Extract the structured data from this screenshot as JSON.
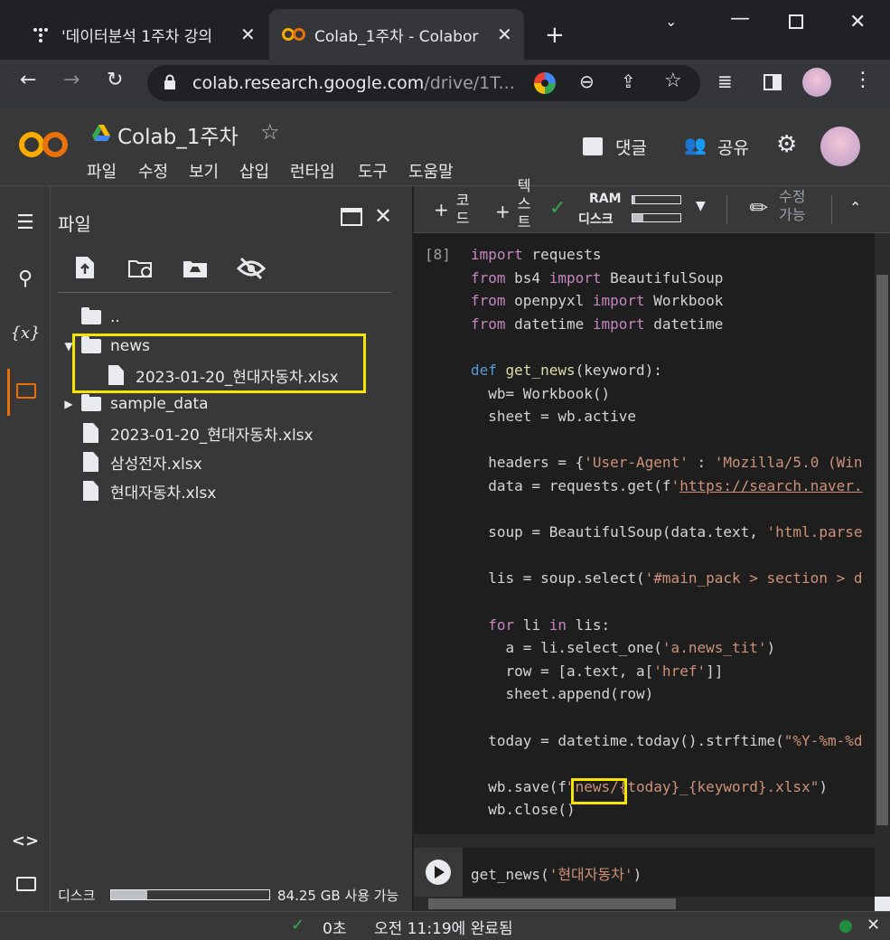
{
  "browser": {
    "tabs": [
      {
        "title": "'데이터분석 1주차 강의",
        "active": false
      },
      {
        "title": "Colab_1주차 - Colabor",
        "active": true
      }
    ],
    "new_tab_label": "+",
    "address": {
      "host": "colab.research.google.com",
      "path": "/drive/1T..."
    }
  },
  "colab": {
    "logo_text": "CO",
    "notebook_title": "Colab_1주차",
    "menu": [
      "파일",
      "수정",
      "보기",
      "삽입",
      "런타임",
      "도구",
      "도움말"
    ],
    "comment_label": "댓글",
    "share_label": "공유"
  },
  "files_panel": {
    "title": "파일",
    "parent_dir": "..",
    "tree": [
      {
        "name": "news",
        "type": "folder",
        "expanded": true
      },
      {
        "name": "2023-01-20_현대자동차.xlsx",
        "type": "file",
        "depth": 1
      },
      {
        "name": "sample_data",
        "type": "folder",
        "expanded": false
      },
      {
        "name": "2023-01-20_현대자동차.xlsx",
        "type": "file",
        "depth": 0
      },
      {
        "name": "삼성전자.xlsx",
        "type": "file",
        "depth": 0
      },
      {
        "name": "현대자동차.xlsx",
        "type": "file",
        "depth": 0
      }
    ],
    "disk_label": "디스크",
    "disk_free": "84.25 GB 사용 가능",
    "disk_usage_fraction": 0.23
  },
  "cell_toolbar": {
    "code_label_1": "코",
    "code_label_2": "드",
    "text_label_1": "텍",
    "text_label_2": "스",
    "text_label_3": "트",
    "ram_label": "RAM",
    "disk_label": "디스크",
    "edit_label_1": "수정",
    "edit_label_2": "가능"
  },
  "cell": {
    "exec_count": "[8]",
    "code_lines": [
      "import requests",
      "from bs4 import BeautifulSoup",
      "from openpyxl import Workbook",
      "from datetime import datetime",
      "",
      "def get_news(keyword):",
      "  wb= Workbook()",
      "  sheet = wb.active",
      "",
      "  headers = {'User-Agent' : 'Mozilla/5.0 (Win",
      "  data = requests.get(f'https://search.naver.",
      "",
      "  soup = BeautifulSoup(data.text, 'html.parse",
      "",
      "  lis = soup.select('#main_pack > section > d",
      "",
      "  for li in lis:",
      "    a = li.select_one('a.news_tit')",
      "    row = [a.text, a['href']]",
      "    sheet.append(row)",
      "",
      "  today = datetime.today().strftime(\"%Y-%m-%d",
      "",
      "  wb.save(f\"news/{today}_{keyword}.xlsx\")",
      "  wb.close()"
    ],
    "next_cell_code": "get_news('현대자동차')"
  },
  "status": {
    "elapsed": "0초",
    "completed": "오전 11:19에 완료됨"
  }
}
